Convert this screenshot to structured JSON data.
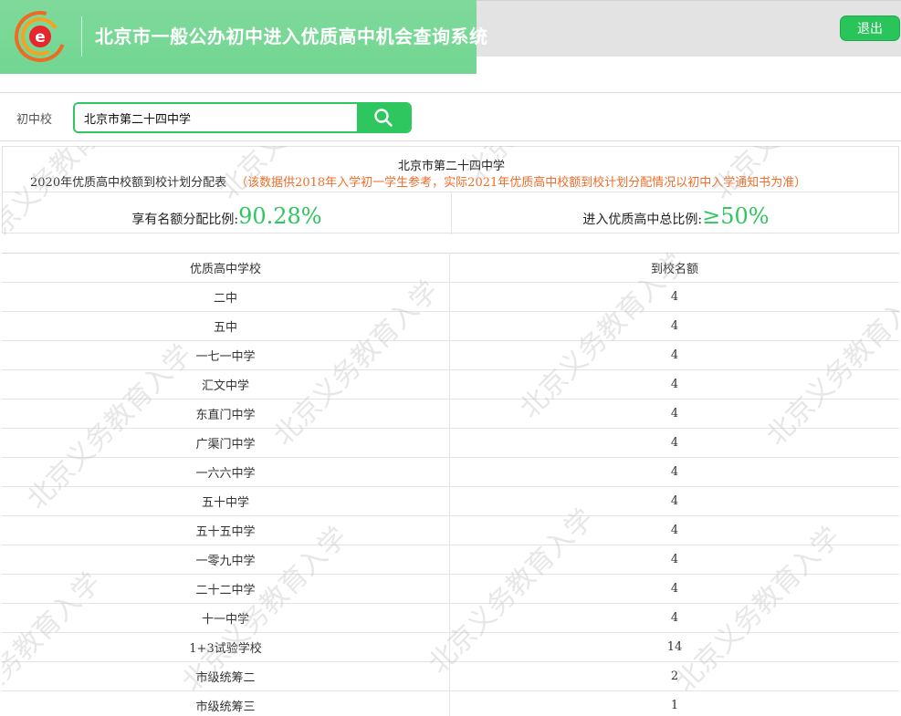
{
  "header": {
    "title": "北京市一般公办初中进入优质高中机会查询系统",
    "logout_label": "退出",
    "logo_letter": "e"
  },
  "search": {
    "label": "初中校",
    "value": "北京市第二十四中学",
    "button_icon": "search-icon"
  },
  "summary": {
    "school": "北京市第二十四中学",
    "plan_title": "2020年优质高中校额到校计划分配表",
    "plan_note": "（该数据供2018年入学初一学生参考，实际2021年优质高中校额到校计划分配情况以初中入学通知书为准）",
    "quota_ratio_label": "享有名额分配比例:",
    "quota_ratio_value": "90.28%",
    "total_ratio_label": "进入优质高中总比例:",
    "total_ratio_value": "≥50%"
  },
  "table": {
    "headers": [
      "优质高中学校",
      "到校名额"
    ],
    "rows": [
      {
        "school": "二中",
        "quota": "4"
      },
      {
        "school": "五中",
        "quota": "4"
      },
      {
        "school": "一七一中学",
        "quota": "4"
      },
      {
        "school": "汇文中学",
        "quota": "4"
      },
      {
        "school": "东直门中学",
        "quota": "4"
      },
      {
        "school": "广渠门中学",
        "quota": "4"
      },
      {
        "school": "一六六中学",
        "quota": "4"
      },
      {
        "school": "五十中学",
        "quota": "4"
      },
      {
        "school": "五十五中学",
        "quota": "4"
      },
      {
        "school": "一零九中学",
        "quota": "4"
      },
      {
        "school": "二十二中学",
        "quota": "4"
      },
      {
        "school": "十一中学",
        "quota": "4"
      },
      {
        "school": "1+3试验学校",
        "quota": "14"
      },
      {
        "school": "市级统筹二",
        "quota": "2"
      },
      {
        "school": "市级统筹三",
        "quota": "1"
      }
    ]
  },
  "watermark": {
    "text": "北京义务教育入学"
  },
  "colors": {
    "accent_green": "#2ec65e",
    "banner_green": "#77d796",
    "note_orange": "#ef6d2a"
  }
}
